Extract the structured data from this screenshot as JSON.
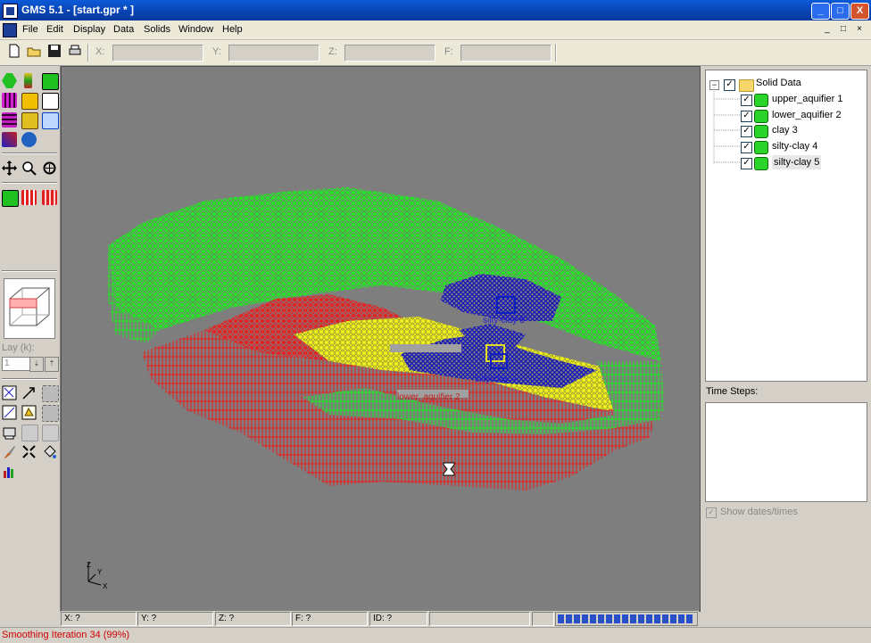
{
  "window": {
    "title": "GMS 5.1 - [start.gpr * ]",
    "minimize": "_",
    "maximize": "□",
    "close": "X"
  },
  "menu": [
    "File",
    "Edit",
    "Display",
    "Data",
    "Solids",
    "Window",
    "Help"
  ],
  "mdi_controls": [
    "_",
    "□",
    "×"
  ],
  "toolbar": {
    "x_label": "X:",
    "y_label": "Y:",
    "z_label": "Z:",
    "f_label": "F:"
  },
  "left": {
    "lay_label": "Lay (k):",
    "lay_value": "1"
  },
  "viewport": {
    "labels": [
      "silty-clay 5",
      "silty-clay 4",
      "lower_aquifier 2"
    ],
    "axis": [
      "Z",
      "Y",
      "X"
    ],
    "colors": {
      "green": "#18f018",
      "red": "#f01818",
      "yellow": "#f8f818",
      "blue": "#1010c0"
    }
  },
  "status": {
    "x": "X: ?",
    "y": "Y: ?",
    "z": "Z: ?",
    "f": "F: ?",
    "id": "ID: ?",
    "progress": 1.0
  },
  "message": "Smoothing Iteration 34 (99%)",
  "tree": {
    "root": "Solid Data",
    "items": [
      "upper_aquifier 1",
      "lower_aquifier 2",
      "clay 3",
      "silty-clay 4",
      "silty-clay 5"
    ]
  },
  "time_steps": {
    "label": "Time Steps:",
    "show_dates": "Show dates/times"
  }
}
